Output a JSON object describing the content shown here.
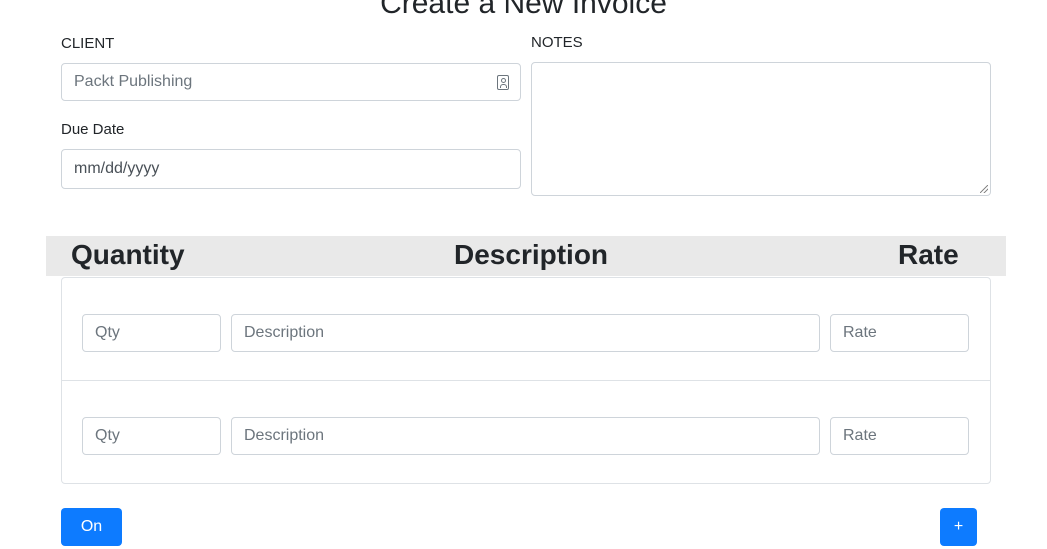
{
  "page": {
    "title": "Create a New Invoice"
  },
  "form": {
    "client_label": "CLIENT",
    "client_value": "Packt Publishing",
    "due_date_label": "Due Date",
    "due_date_placeholder": "mm/dd/yyyy",
    "notes_label": "NOTES",
    "notes_value": ""
  },
  "items": {
    "headers": [
      "Quantity",
      "Description",
      "Rate"
    ],
    "rows": [
      {
        "qty_placeholder": "Qty",
        "description_placeholder": "Description",
        "rate_placeholder": "Rate"
      },
      {
        "qty_placeholder": "Qty",
        "description_placeholder": "Description",
        "rate_placeholder": "Rate"
      }
    ]
  },
  "actions": {
    "toggle_label": "On",
    "add_label": "+"
  },
  "icons": {
    "client_field_icon": "contact-card-icon"
  },
  "colors": {
    "primary": "#0d7bff",
    "header_bg": "#e9e9e9",
    "border": "#ced4da"
  }
}
